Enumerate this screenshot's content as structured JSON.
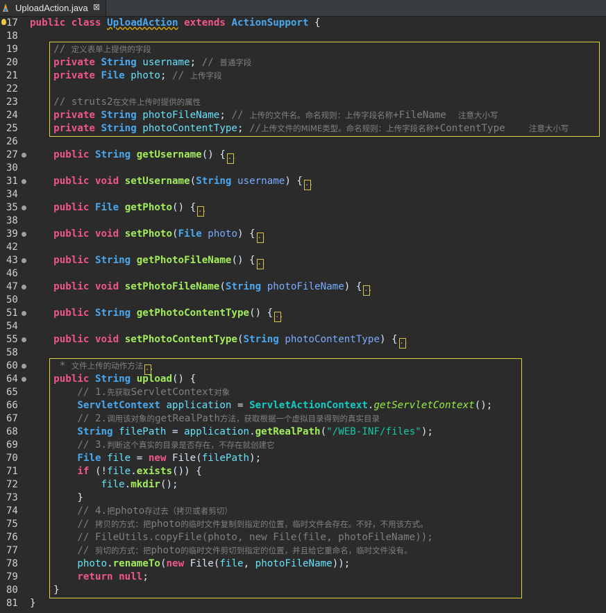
{
  "tab": {
    "title": "UploadAction.java",
    "close_symbol": "⊠"
  },
  "line_numbers": [
    "17",
    "18",
    "19",
    "20",
    "21",
    "22",
    "23",
    "24",
    "25",
    "26",
    "27",
    "30",
    "31",
    "34",
    "35",
    "38",
    "39",
    "42",
    "43",
    "46",
    "47",
    "50",
    "51",
    "54",
    "55",
    "58",
    "60",
    "64",
    "65",
    "66",
    "67",
    "68",
    "69",
    "70",
    "71",
    "72",
    "73",
    "74",
    "75",
    "76",
    "77",
    "78",
    "79",
    "80",
    "81"
  ],
  "code": {
    "l17": {
      "public": "public",
      "class": "class",
      "name": "UploadAction",
      "extends": "extends",
      "parent": "ActionSupport",
      "brace": "{"
    },
    "l19": {
      "comment": "// ",
      "comment_cn": "定义表单上提供的字段"
    },
    "l20": {
      "private": "private",
      "type": "String",
      "field": "username",
      "semi": ";",
      "comment": " // ",
      "comment_cn": "普通字段"
    },
    "l21": {
      "private": "private",
      "type": "File",
      "field": "photo",
      "semi": ";",
      "comment": " // ",
      "comment_cn": "上传字段"
    },
    "l23": {
      "comment": "// struts2",
      "comment_cn": "在文件上传时提供的属性"
    },
    "l24": {
      "private": "private",
      "type": "String",
      "field": "photoFileName",
      "semi": ";",
      "comment": " // ",
      "comment_cn1": "上传的文件名。命名规则：上传字段名称",
      "comment_mid": "+FileName  ",
      "comment_cn2": "注意大小写"
    },
    "l25": {
      "private": "private",
      "type": "String",
      "field": "photoContentType",
      "semi": ";",
      "comment": " //",
      "comment_cn1": "上传文件的",
      "comment_mime": "MIME",
      "comment_cn2": "类型。命名规则：上传字段名称",
      "comment_mid": "+ContentType    ",
      "comment_cn3": "注意大小写"
    },
    "l27": {
      "public": "public",
      "type": "String",
      "method": "getUsername",
      "params": "() {"
    },
    "l31": {
      "public": "public",
      "type": "void",
      "method": "setUsername",
      "paren_open": "(",
      "ptype": "String",
      "pname": "username",
      "paren_close": ") {"
    },
    "l35": {
      "public": "public",
      "type": "File",
      "method": "getPhoto",
      "params": "() {"
    },
    "l39": {
      "public": "public",
      "type": "void",
      "method": "setPhoto",
      "paren_open": "(",
      "ptype": "File",
      "pname": "photo",
      "paren_close": ") {"
    },
    "l43": {
      "public": "public",
      "type": "String",
      "method": "getPhotoFileName",
      "params": "() {"
    },
    "l47": {
      "public": "public",
      "type": "void",
      "method": "setPhotoFileName",
      "paren_open": "(",
      "ptype": "String",
      "pname": "photoFileName",
      "paren_close": ") {"
    },
    "l51": {
      "public": "public",
      "type": "String",
      "method": "getPhotoContentType",
      "params": "() {"
    },
    "l55": {
      "public": "public",
      "type": "void",
      "method": "setPhotoContentType",
      "paren_open": "(",
      "ptype": "String",
      "pname": "photoContentType",
      "paren_close": ") {"
    },
    "l60": {
      "comment": " * ",
      "comment_cn": "文件上传的动作方法"
    },
    "l64": {
      "public": "public",
      "type": "String",
      "method": "upload",
      "params": "() {"
    },
    "l65": {
      "comment": "// 1.",
      "comment_cn": "先获取",
      "comment_rest": "ServletContext",
      "comment_cn2": "对象"
    },
    "l66": {
      "type": "ServletContext",
      "var": "application",
      "eq": " = ",
      "cls": "ServletActionContext",
      "dot": ".",
      "call": "getServletContext",
      "end": "();"
    },
    "l67": {
      "comment": "// 2.",
      "comment_cn": "调用该对象的",
      "comment_rest": "getRealPath",
      "comment_cn2": "方法，获取根据一个虚拟目录得到的真实目录"
    },
    "l68": {
      "type": "String",
      "var": "filePath",
      "eq": " = ",
      "obj": "application",
      "dot": ".",
      "call": "getRealPath",
      "open": "(",
      "str": "\"/WEB-INF/files\"",
      "end": ");"
    },
    "l69": {
      "comment": "// 3.",
      "comment_cn": "判断这个真实的目录是否存在，不存在就创建它"
    },
    "l70": {
      "type": "File",
      "var": "file",
      "eq": " = ",
      "new": "new",
      "ctor": " File",
      "open": "(",
      "arg": "filePath",
      "end": ");"
    },
    "l71": {
      "if": "if",
      "open": " (!",
      "obj": "file",
      "dot": ".",
      "call": "exists",
      "end": "()) {"
    },
    "l72": {
      "obj": "file",
      "dot": ".",
      "call": "mkdir",
      "end": "();"
    },
    "l73": {
      "brace": "}"
    },
    "l74": {
      "comment": "// 4.",
      "comment_cn": "把",
      "comment_rest": "photo",
      "comment_cn2": "存过去（拷贝或者剪切）"
    },
    "l75": {
      "comment": "// ",
      "comment_cn": "拷贝的方式：把",
      "comment_rest": "photo",
      "comment_cn2": "的临时文件复制到指定的位置，临时文件会存在。不好，不用该方式。"
    },
    "l76": {
      "comment": "// FileUtils.copyFile(photo, new File(file, photoFileName));"
    },
    "l77": {
      "comment": "// ",
      "comment_cn": "剪切的方式：把",
      "comment_rest": "photo",
      "comment_cn2": "的临时文件剪切到指定的位置，并且给它重命名，临时文件没有。"
    },
    "l78": {
      "obj": "photo",
      "dot": ".",
      "call": "renameTo",
      "open": "(",
      "new": "new",
      "ctor": " File",
      "open2": "(",
      "arg1": "file",
      "comma": ", ",
      "arg2": "photoFileName",
      "end": "));"
    },
    "l79": {
      "return": "return",
      "val": " null",
      "semi": ";"
    },
    "l80": {
      "brace": "}"
    },
    "l81": {
      "brace": "}"
    }
  },
  "colors": {
    "background": "#2b2b2b",
    "keyword": "#f0558d",
    "type": "#4aa8f0",
    "comment": "#808080",
    "method": "#a3ec5a",
    "string": "#17c6a3",
    "highlight_box": "#e3d140"
  }
}
